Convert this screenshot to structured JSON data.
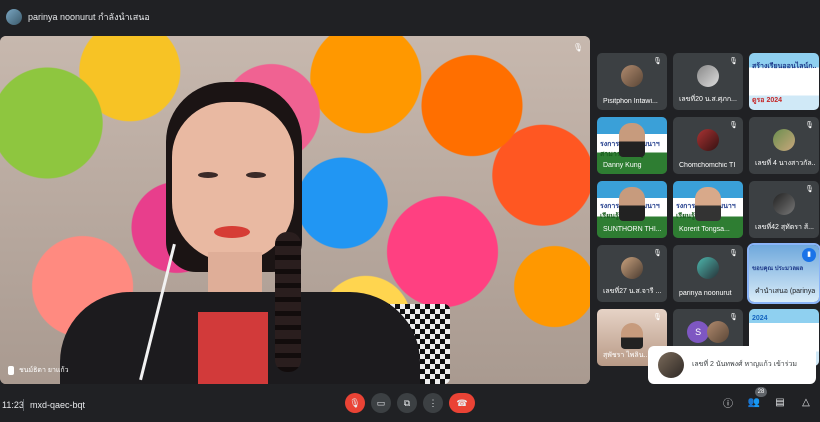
{
  "presenting": {
    "label": "parinya noonurut กำลังนำเสนอ"
  },
  "main_tile": {
    "name": "ชนม์ธิดา ยาแก้ว"
  },
  "grid": [
    {
      "name": "Pisitphon Intawi..."
    },
    {
      "name": "เลขที่20 น.ส.ศุภก..."
    },
    {
      "name": "",
      "slide_text_top": "สร้างเรียนออนไลน์ก..",
      "slide_text_bottom": "ดูรอ 2024"
    },
    {
      "name": "Danny Kung",
      "slide_text_top": "รงการอบรมพัฒนาฯ",
      "slide_text_bottom": "สามารถเรียนรู้"
    },
    {
      "name": "Chomchomchic TI"
    },
    {
      "name": "เลขที่ 4 นางสาวกัล..."
    },
    {
      "name": "SUNTHORN THI...",
      "slide_text_top": "รงการอบรมพัฒนาฯ",
      "slide_text_bottom": "เรียนรู้"
    },
    {
      "name": "Korerit Tongsa...",
      "slide_text_top": "รงการอบรมพัฒนาฯ",
      "slide_text_bottom": "เรียนรู้"
    },
    {
      "name": "เลขที่42 สุทัตรา ส้..."
    },
    {
      "name": "เลขที่27 น.ส.จารี ..."
    },
    {
      "name": "parinya noonurut"
    },
    {
      "name": "คำนำเสนอ (parinya n...",
      "slide_text_top": "ขอบคุณ  ประมวลผล"
    },
    {
      "name": "สุพัชรา ไพลิน..."
    },
    {
      "name": "",
      "initial": "S"
    },
    {
      "name": "",
      "slide_text_top": "2024"
    }
  ],
  "toast": {
    "text": "เลขที่ 2 นันทพงศ์ หาญแก้ว เข้าร่วม"
  },
  "bottom": {
    "time": "11:23",
    "meeting_code": "mxd-qaec-bqt",
    "participants_count": "28"
  }
}
